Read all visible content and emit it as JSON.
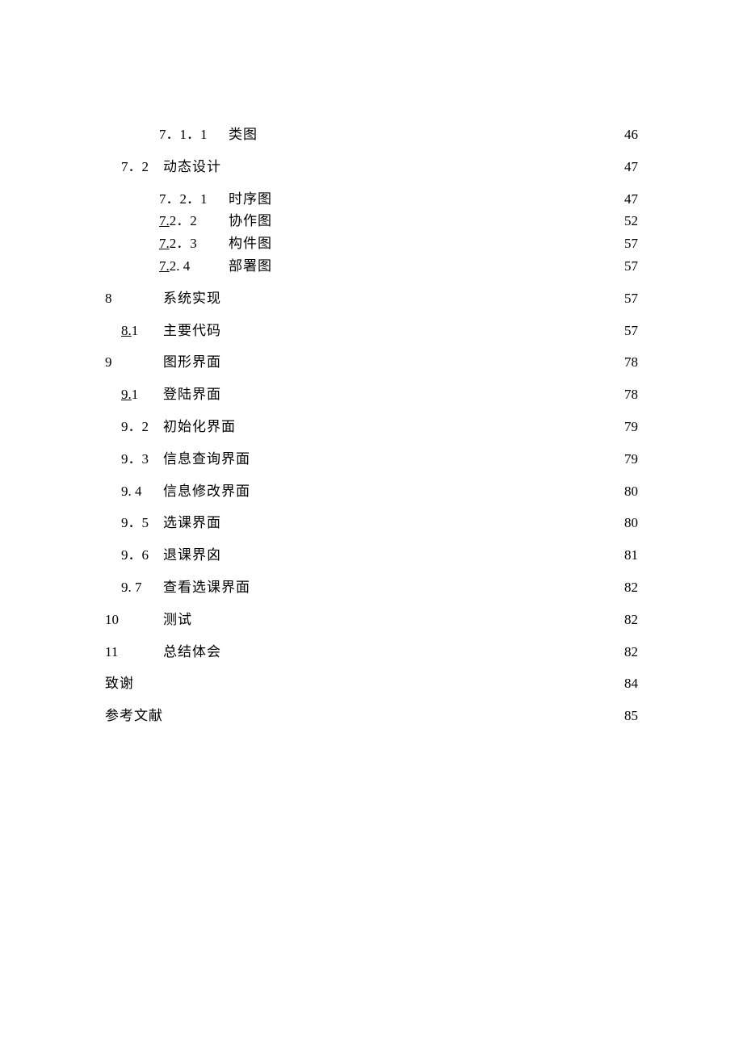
{
  "toc": [
    {
      "level": 3,
      "num": "7．1．1",
      "ul": "",
      "title": "类图",
      "page": "46",
      "nospace": true
    },
    {
      "level": 2,
      "num": "7．2",
      "ul": "",
      "title": "动态设计",
      "page": "47"
    },
    {
      "level": 3,
      "num": "7．2．1",
      "ul": "",
      "title": "时序图",
      "page": "47",
      "nospace": true
    },
    {
      "level": 3,
      "num": "7．2．2",
      "ul": "7.",
      "title": "协作图",
      "page": "52",
      "nospace": true
    },
    {
      "level": 3,
      "num": "7．2．3",
      "ul": "7.",
      "title": "构件图",
      "page": "57",
      "nospace": true
    },
    {
      "level": 3,
      "num": "7．2. 4",
      "ul": "7.",
      "title": "部署图",
      "page": "57",
      "nospace": true
    },
    {
      "level": 1,
      "num": "8",
      "ul": "",
      "title": "系统实现",
      "page": "57"
    },
    {
      "level": 2,
      "num": "8．1",
      "ul": "8.",
      "title": "主要代码",
      "page": "57"
    },
    {
      "level": 1,
      "num": "9",
      "ul": "",
      "title": "图形界面",
      "page": "78"
    },
    {
      "level": 2,
      "num": "9．1",
      "ul": "9.",
      "title": "登陆界面",
      "page": "78"
    },
    {
      "level": 2,
      "num": "9．2",
      "ul": "",
      "title": "初始化界面",
      "page": "79"
    },
    {
      "level": 2,
      "num": "9．3",
      "ul": "",
      "title": "信息查询界面",
      "page": "79"
    },
    {
      "level": 2,
      "num": "9. 4",
      "ul": "",
      "title": "信息修改界面",
      "page": "80"
    },
    {
      "level": 2,
      "num": "9．5",
      "ul": "",
      "title": "选课界面",
      "page": "80"
    },
    {
      "level": 2,
      "num": "9．6",
      "ul": "",
      "title": "退课界囟",
      "page": "81"
    },
    {
      "level": 2,
      "num": "9. 7",
      "ul": "",
      "title": "查看选课界面",
      "page": "82"
    },
    {
      "level": 1,
      "num": "10",
      "ul": "",
      "title": "测试",
      "page": "82"
    },
    {
      "level": 1,
      "num": "11",
      "ul": "",
      "title": "总结体会",
      "page": "82"
    },
    {
      "level": 0,
      "num": "",
      "ul": "",
      "title": "致谢",
      "page": "84",
      "nospace": true
    },
    {
      "level": 0,
      "num": "",
      "ul": "",
      "title": "参考文献",
      "page": "85",
      "nospace": true
    }
  ]
}
